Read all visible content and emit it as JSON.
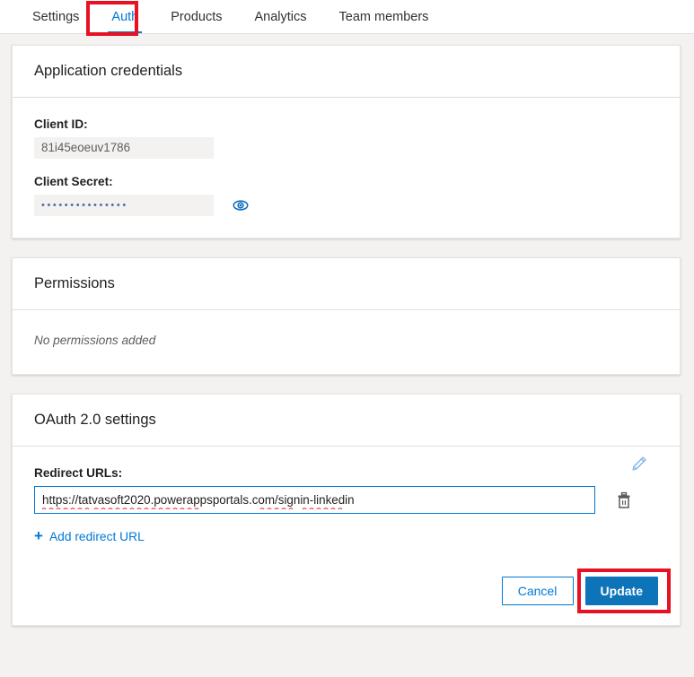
{
  "tabs": [
    {
      "label": "Settings",
      "active": false
    },
    {
      "label": "Auth",
      "active": true
    },
    {
      "label": "Products",
      "active": false
    },
    {
      "label": "Analytics",
      "active": false
    },
    {
      "label": "Team members",
      "active": false
    }
  ],
  "credentials": {
    "panel_title": "Application credentials",
    "client_id_label": "Client ID:",
    "client_id_value": "81i45eoeuv1786",
    "client_secret_label": "Client Secret:",
    "client_secret_masked": "•••••••••••••••",
    "reveal_icon": "eye-icon"
  },
  "permissions": {
    "panel_title": "Permissions",
    "empty_text": "No permissions added"
  },
  "oauth": {
    "panel_title": "OAuth 2.0 settings",
    "redirect_label": "Redirect URLs:",
    "redirect_url": "https://tatvasoft2020.powerappsportals.com/signin-linkedin",
    "redirect_placeholder": "https://",
    "edit_icon": "pencil-icon",
    "delete_icon": "trash-icon",
    "add_link_label": "Add redirect URL",
    "add_icon": "plus-icon",
    "cancel_label": "Cancel",
    "update_label": "Update"
  },
  "colors": {
    "accent": "#0078d4",
    "primary_button": "#0d74ba",
    "highlight": "#e81123",
    "page_bg": "#f3f2f1",
    "text": "#201f1e",
    "muted_text": "#605e5c",
    "spellcheck_underline": "#e81123"
  }
}
